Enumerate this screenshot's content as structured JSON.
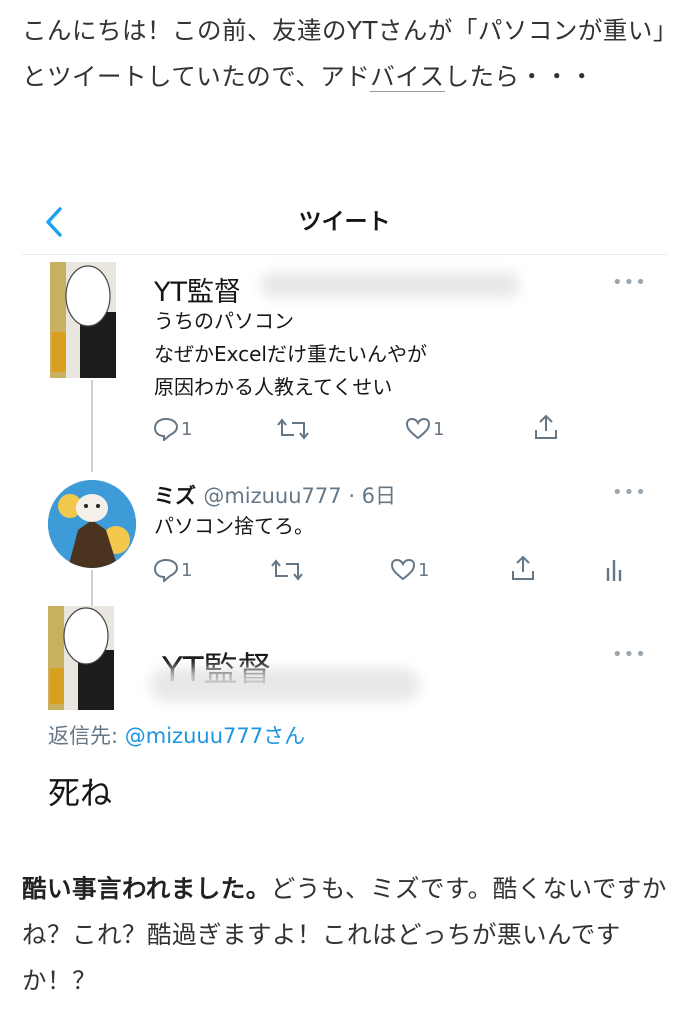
{
  "article": {
    "intro_part1": "こんにちは！この前、友達のYTさんが「パソコンが重い」とツイートしていたので、アド",
    "intro_link": "バイス",
    "intro_part2": "したら・・・",
    "outro_bold": "酷い事言われました。",
    "outro_rest": "どうも、ミズです。酷くないですかね？これ？酷過ぎますよ！これはどっちが悪いんですか！？"
  },
  "twitter": {
    "header_title": "ツイート",
    "tweet1": {
      "name": "YT監督",
      "lines": [
        "うちのパソコン",
        "なぜかExcelだけ重たいんやが",
        "原因わかる人教えてくせい"
      ],
      "reply_count": "1",
      "like_count": "1"
    },
    "tweet2": {
      "name": "ミズ",
      "handle_time": "@mizuuu777 · 6日",
      "text": "パソコン捨てろ。",
      "reply_count": "1",
      "like_count": "1"
    },
    "tweet3": {
      "name": "YT監督",
      "reply_label": "返信先: ",
      "reply_mention": "@mizuuu777さん",
      "text": "死ね"
    },
    "more_label": "•••",
    "icons": [
      "back-chevron-icon",
      "reply-icon",
      "retweet-icon",
      "like-icon",
      "share-icon",
      "analytics-icon",
      "more-icon"
    ],
    "colors": {
      "accent": "#1da1f2",
      "icon_gray": "#657786",
      "mention": "#1b95e0"
    }
  }
}
